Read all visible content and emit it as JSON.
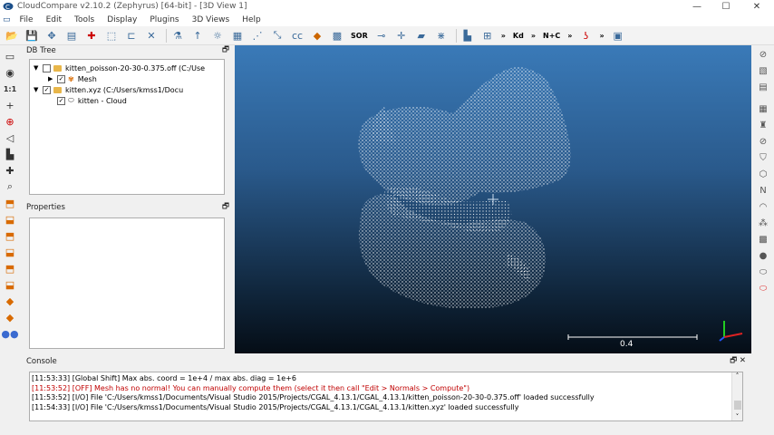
{
  "window": {
    "title": "CloudCompare v2.10.2 (Zephyrus) [64-bit] - [3D View 1]",
    "minimize": "—",
    "maximize": "☐",
    "close": "✕"
  },
  "menu": [
    "File",
    "Edit",
    "Tools",
    "Display",
    "Plugins",
    "3D Views",
    "Help"
  ],
  "toolbar": {
    "sor_label": "SOR",
    "kd_label": "Kd",
    "nc_label": "N+C",
    "more_label": "»"
  },
  "db_tree": {
    "title": "DB Tree",
    "items": [
      {
        "label": "kitten_poisson-20-30-0.375.off (C:/Use",
        "checked": false
      },
      {
        "label": "Mesh",
        "checked": true
      },
      {
        "label": "kitten.xyz (C:/Users/kmss1/Docu",
        "checked": true
      },
      {
        "label": "kitten - Cloud",
        "checked": true
      }
    ]
  },
  "properties": {
    "title": "Properties"
  },
  "view": {
    "scale_label": "0.4",
    "colors": {
      "bg_top": "#3a7ab8",
      "bg_bottom": "#050d16",
      "points": "#ffffff"
    }
  },
  "console": {
    "title": "Console",
    "lines": [
      {
        "text": "[11:53:33] [Global Shift] Max abs. coord = 1e+4 / max abs. diag = 1e+6",
        "color": "#000000"
      },
      {
        "text": "[11:53:52] [OFF] Mesh has no normal! You can manually compute them (select it then call \"Edit > Normals > Compute\")",
        "color": "#c00000"
      },
      {
        "text": "[11:53:52] [I/O] File 'C:/Users/kmss1/Documents/Visual Studio 2015/Projects/CGAL_4.13.1/CGAL_4.13.1/kitten_poisson-20-30-0.375.off' loaded successfully",
        "color": "#000000"
      },
      {
        "text": "[11:54:33] [I/O] File 'C:/Users/kmss1/Documents/Visual Studio 2015/Projects/CGAL_4.13.1/CGAL_4.13.1/kitten.xyz' loaded successfully",
        "color": "#000000"
      }
    ]
  }
}
